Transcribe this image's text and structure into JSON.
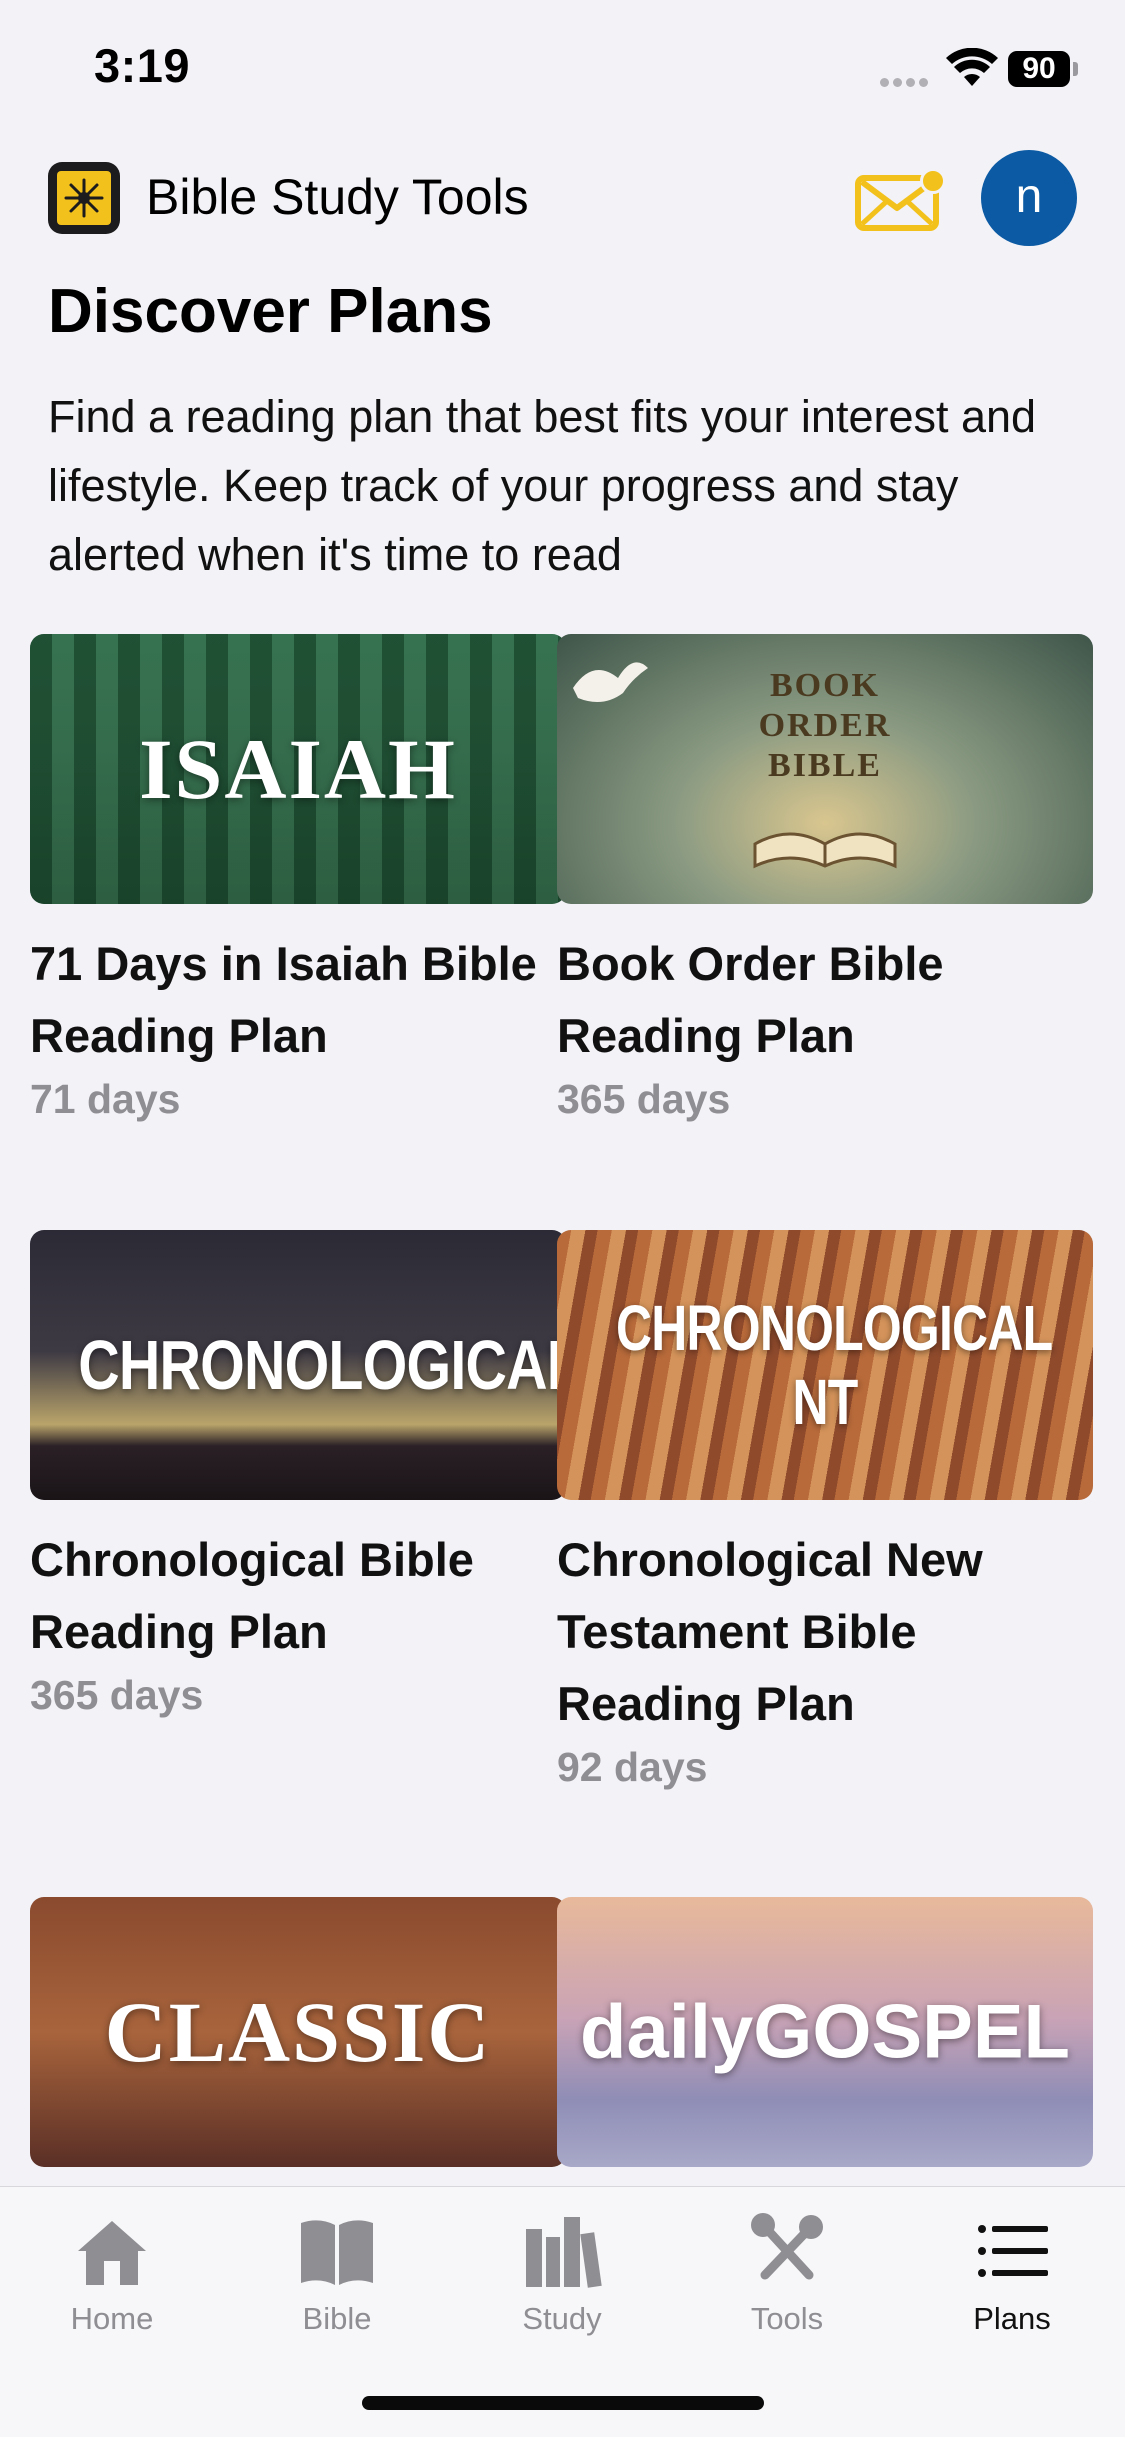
{
  "status_bar": {
    "time": "3:19",
    "battery": "90"
  },
  "header": {
    "app_title": "Bible Study Tools",
    "avatar_initial": "n"
  },
  "page": {
    "title": "Discover Plans",
    "description": "Find a reading plan that best fits your interest and lifestyle. Keep track of your progress and stay alerted when it's time to read"
  },
  "plans": [
    {
      "image_text": "ISAIAH",
      "title": "71 Days in Isaiah Bible Reading Plan",
      "days": "71 days"
    },
    {
      "image_text": "BOOK ORDER BIBLE",
      "title": "Book Order Bible Reading Plan",
      "days": "365 days"
    },
    {
      "image_text": "CHRONOLOGICAL",
      "title": "Chronological Bible Reading Plan",
      "days": "365 days"
    },
    {
      "image_text": "CHRONOLOGICAL NT",
      "title": "Chronological New Testament Bible Reading Plan",
      "days": "92 days"
    },
    {
      "image_text": "CLASSIC",
      "title": "",
      "days": ""
    },
    {
      "image_text": "dailyGOSPEL",
      "title": "",
      "days": ""
    }
  ],
  "tabs": [
    {
      "label": "Home",
      "icon": "house-icon"
    },
    {
      "label": "Bible",
      "icon": "book-icon"
    },
    {
      "label": "Study",
      "icon": "books-icon"
    },
    {
      "label": "Tools",
      "icon": "wrench-screwdriver-icon"
    },
    {
      "label": "Plans",
      "icon": "list-icon",
      "active": true
    }
  ],
  "colors": {
    "accent": "#f3c11b",
    "avatar": "#0b5aa3",
    "muted": "#8e8e93"
  }
}
